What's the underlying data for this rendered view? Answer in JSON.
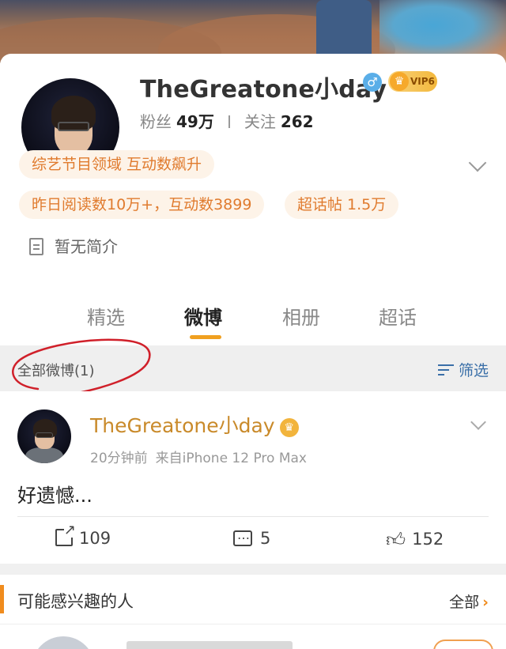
{
  "profile": {
    "username": "TheGreatone小day",
    "gender_icon": "♂",
    "vip_label": "VIP6",
    "fans_label": "粉丝",
    "fans_count": "49万",
    "following_label": "关注",
    "following_count": "262",
    "tags": [
      "综艺节目领域 互动数飙升",
      "昨日阅读数10万+，互动数3899",
      "超话帖 1.5万"
    ],
    "intro": "暂无简介"
  },
  "tabs": [
    {
      "label": "精选",
      "active": false
    },
    {
      "label": "微博",
      "active": true
    },
    {
      "label": "相册",
      "active": false
    },
    {
      "label": "超话",
      "active": false
    }
  ],
  "filter_bar": {
    "all_label": "全部微博(1)",
    "filter_label": "筛选"
  },
  "post": {
    "author": "TheGreatone小day",
    "time": "20分钟前",
    "source": "来自iPhone 12 Pro Max",
    "text": "好遗憾...",
    "reposts": "109",
    "comments": "5",
    "likes": "152"
  },
  "recommend": {
    "title": "可能感兴趣的人",
    "all_label": "全部"
  },
  "colors": {
    "accent": "#f0a020",
    "tag_text": "#e07b2e",
    "tag_bg": "#fdf3e8",
    "author": "#c98a2a",
    "filter": "#3a6fa8",
    "annotation": "#d0202a"
  }
}
